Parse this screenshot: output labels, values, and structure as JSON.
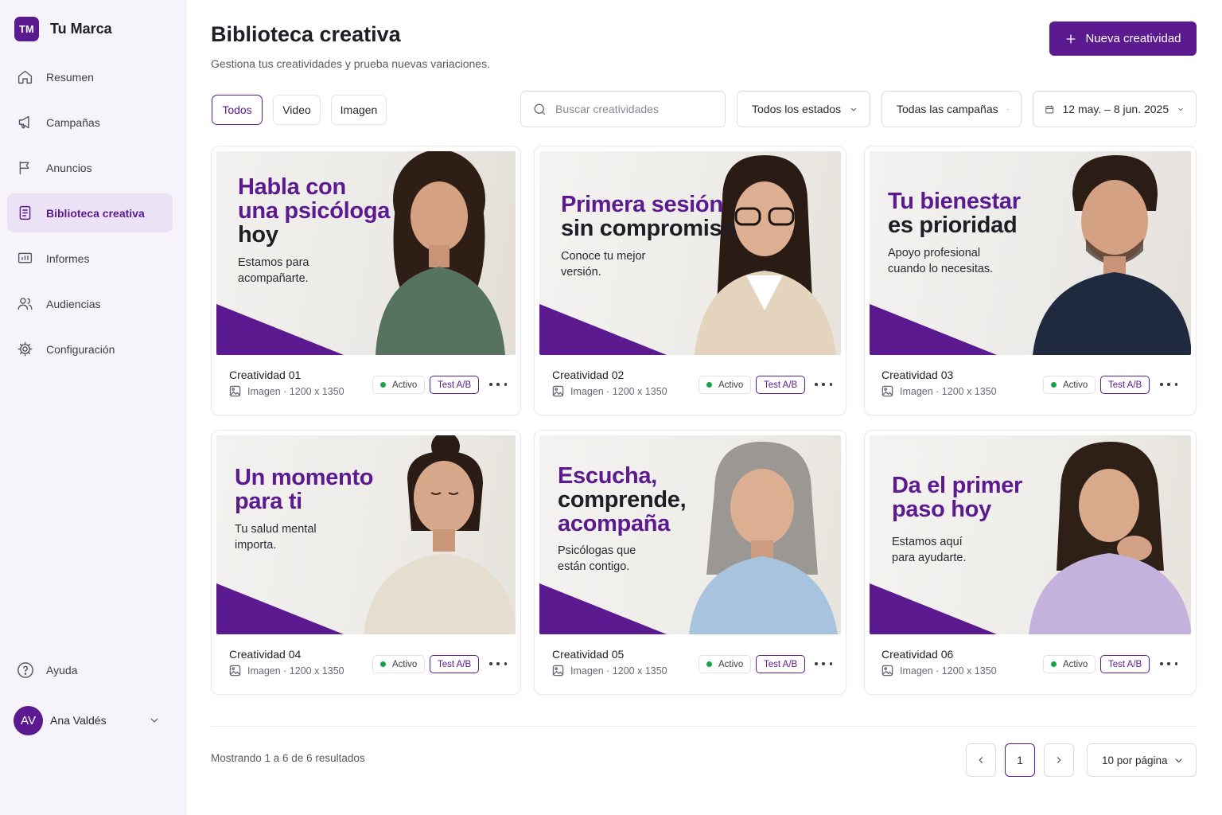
{
  "brand": {
    "logo": "TM",
    "name": "Tu Marca"
  },
  "sidebar": {
    "items": [
      {
        "label": "Resumen",
        "icon": "home-icon"
      },
      {
        "label": "Campañas",
        "icon": "megaphone-icon"
      },
      {
        "label": "Anuncios",
        "icon": "flag-icon"
      },
      {
        "label": "Biblioteca creativa",
        "icon": "document-icon",
        "active": true
      },
      {
        "label": "Informes",
        "icon": "chart-board-icon"
      },
      {
        "label": "Audiencias",
        "icon": "users-icon"
      },
      {
        "label": "Configuración",
        "icon": "gear-icon"
      }
    ],
    "help": "Ayuda",
    "user": {
      "initials": "AV",
      "name": "Ana Valdés"
    }
  },
  "header": {
    "title": "Biblioteca creativa",
    "subtitle": "Gestiona tus creatividades y prueba nuevas variaciones.",
    "new_button": "Nueva creatividad"
  },
  "filters": {
    "tabs": [
      "Todos",
      "Video",
      "Imagen"
    ],
    "active_tab": "Todos",
    "search_placeholder": "Buscar creatividades",
    "status": "Todos los estados",
    "campaigns": "Todas las campañas",
    "date_range": "12 may. – 8 jun. 2025"
  },
  "cards": [
    {
      "name": "Creatividad 01",
      "meta": "Imagen · 1200 x 1350",
      "status": "Activo",
      "test": "Test A/B",
      "headline": [
        "Habla con",
        "una psicóloga",
        "hoy"
      ],
      "sub": [
        "Estamos para",
        "acompañarte."
      ]
    },
    {
      "name": "Creatividad 02",
      "meta": "Imagen · 1200 x 1350",
      "status": "Activo",
      "test": "Test A/B",
      "headline": [
        "Primera sesión",
        "sin compromiso"
      ],
      "sub": [
        "Conoce tu mejor",
        "versión."
      ]
    },
    {
      "name": "Creatividad 03",
      "meta": "Imagen · 1200 x 1350",
      "status": "Activo",
      "test": "Test A/B",
      "headline": [
        "Tu bienestar",
        "es prioridad"
      ],
      "sub": [
        "Apoyo profesional",
        "cuando lo necesitas."
      ]
    },
    {
      "name": "Creatividad 04",
      "meta": "Imagen · 1200 x 1350",
      "status": "Activo",
      "test": "Test A/B",
      "headline": [
        "Un momento",
        "para ti"
      ],
      "sub": [
        "Tu salud mental",
        "importa."
      ]
    },
    {
      "name": "Creatividad 05",
      "meta": "Imagen · 1200 x 1350",
      "status": "Activo",
      "test": "Test A/B",
      "headline": [
        "Escucha,",
        "comprende,",
        "acompaña"
      ],
      "sub": [
        "Psicólogas que",
        "están contigo."
      ]
    },
    {
      "name": "Creatividad 06",
      "meta": "Imagen · 1200 x 1350",
      "status": "Activo",
      "test": "Test A/B",
      "headline": [
        "Da el primer",
        "paso hoy"
      ],
      "sub": [
        "Estamos aquí",
        "para ayudarte."
      ]
    }
  ],
  "footer": {
    "results": "Mostrando 1 a 6 de 6 resultados",
    "page": "1",
    "per_page": "10 por página"
  },
  "colors": {
    "accent": "#5b1a8f",
    "active_dot": "#16a34a",
    "sidebar_bg": "#f6f4fa"
  }
}
